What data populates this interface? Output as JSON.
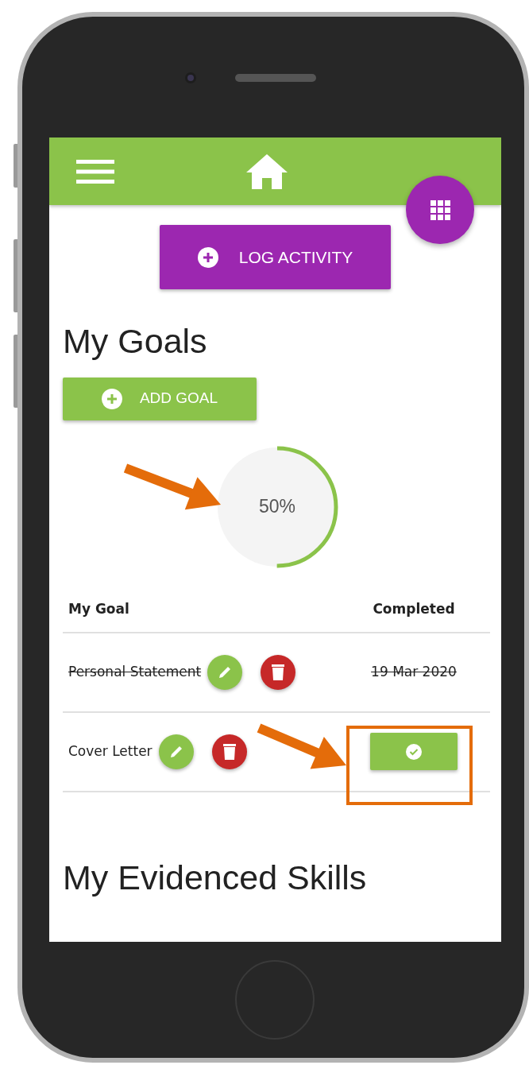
{
  "log_activity_button": {
    "label": "LOG ACTIVITY"
  },
  "goals_heading": "My Goals",
  "add_goal_button": {
    "label": "ADD GOAL"
  },
  "progress": {
    "level": 0.5,
    "reading": "50%"
  },
  "goals_table": {
    "columns": [
      "My Goal",
      "Completed"
    ],
    "rows": [
      {
        "title": "Personal Statement",
        "completed": true,
        "completed_on": "19 Mar 2020"
      },
      {
        "title": "Cover Letter",
        "completed": false
      }
    ]
  },
  "skills_heading": "My Evidenced Skills"
}
